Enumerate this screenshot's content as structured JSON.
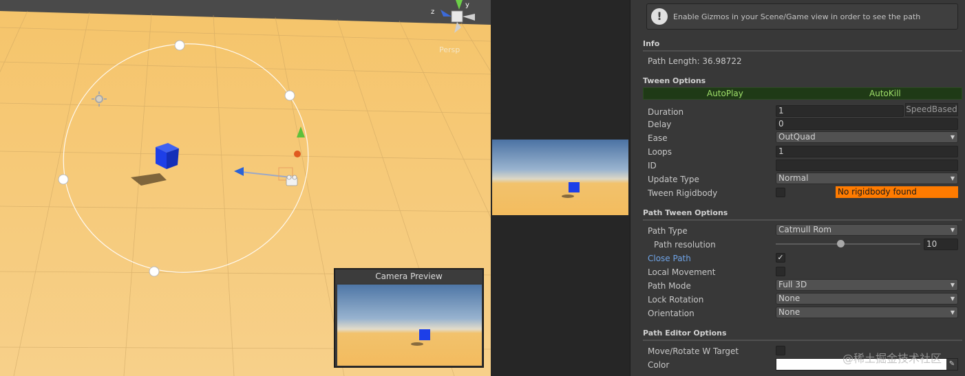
{
  "scene": {
    "persp_label": "Persp",
    "camera_preview_title": "Camera Preview",
    "colors": {
      "ground": "#f2bf66",
      "cube": "#1d3fe8",
      "path_line": "#ffffff"
    },
    "icons": [
      "sun-light-icon",
      "camera-gizmo-icon",
      "orientation-gizmo-icon",
      "waypoint-handle-icon"
    ]
  },
  "inspector": {
    "warning": "Enable Gizmos in your Scene/Game view in order to see the path",
    "info_header": "Info",
    "path_length": "Path Length: 36.98722",
    "tween_options": {
      "header": "Tween Options",
      "autoplay": "AutoPlay",
      "autokill": "AutoKill",
      "duration_label": "Duration",
      "duration_value": "1",
      "speedbased_label": "SpeedBased",
      "delay_label": "Delay",
      "delay_value": "0",
      "ease_label": "Ease",
      "ease_value": "OutQuad",
      "loops_label": "Loops",
      "loops_value": "1",
      "id_label": "ID",
      "id_value": "",
      "update_type_label": "Update Type",
      "update_type_value": "Normal",
      "tween_rigidbody_label": "Tween Rigidbody",
      "tween_rigidbody_checked": false,
      "no_rigidbody_text": "No rigidbody found"
    },
    "path_tween_options": {
      "header": "Path Tween Options",
      "path_type_label": "Path Type",
      "path_type_value": "Catmull Rom",
      "path_resolution_label": "Path resolution",
      "path_resolution_value": "10",
      "close_path_label": "Close Path",
      "close_path_checked": true,
      "local_movement_label": "Local Movement",
      "local_movement_checked": false,
      "path_mode_label": "Path Mode",
      "path_mode_value": "Full 3D",
      "lock_rotation_label": "Lock Rotation",
      "lock_rotation_value": "None",
      "orientation_label": "Orientation",
      "orientation_value": "None"
    },
    "path_editor_options": {
      "header": "Path Editor Options",
      "move_rotate_label": "Move/Rotate W Target",
      "move_rotate_checked": false,
      "color_label": "Color",
      "color_value": "#ffffff"
    },
    "watermark": "@稀土掘金技术社区",
    "colors": {
      "toggle_text": "#9fe06a",
      "highlight_label": "#6fa3e6",
      "warning_bg": "#ff7b00"
    }
  }
}
